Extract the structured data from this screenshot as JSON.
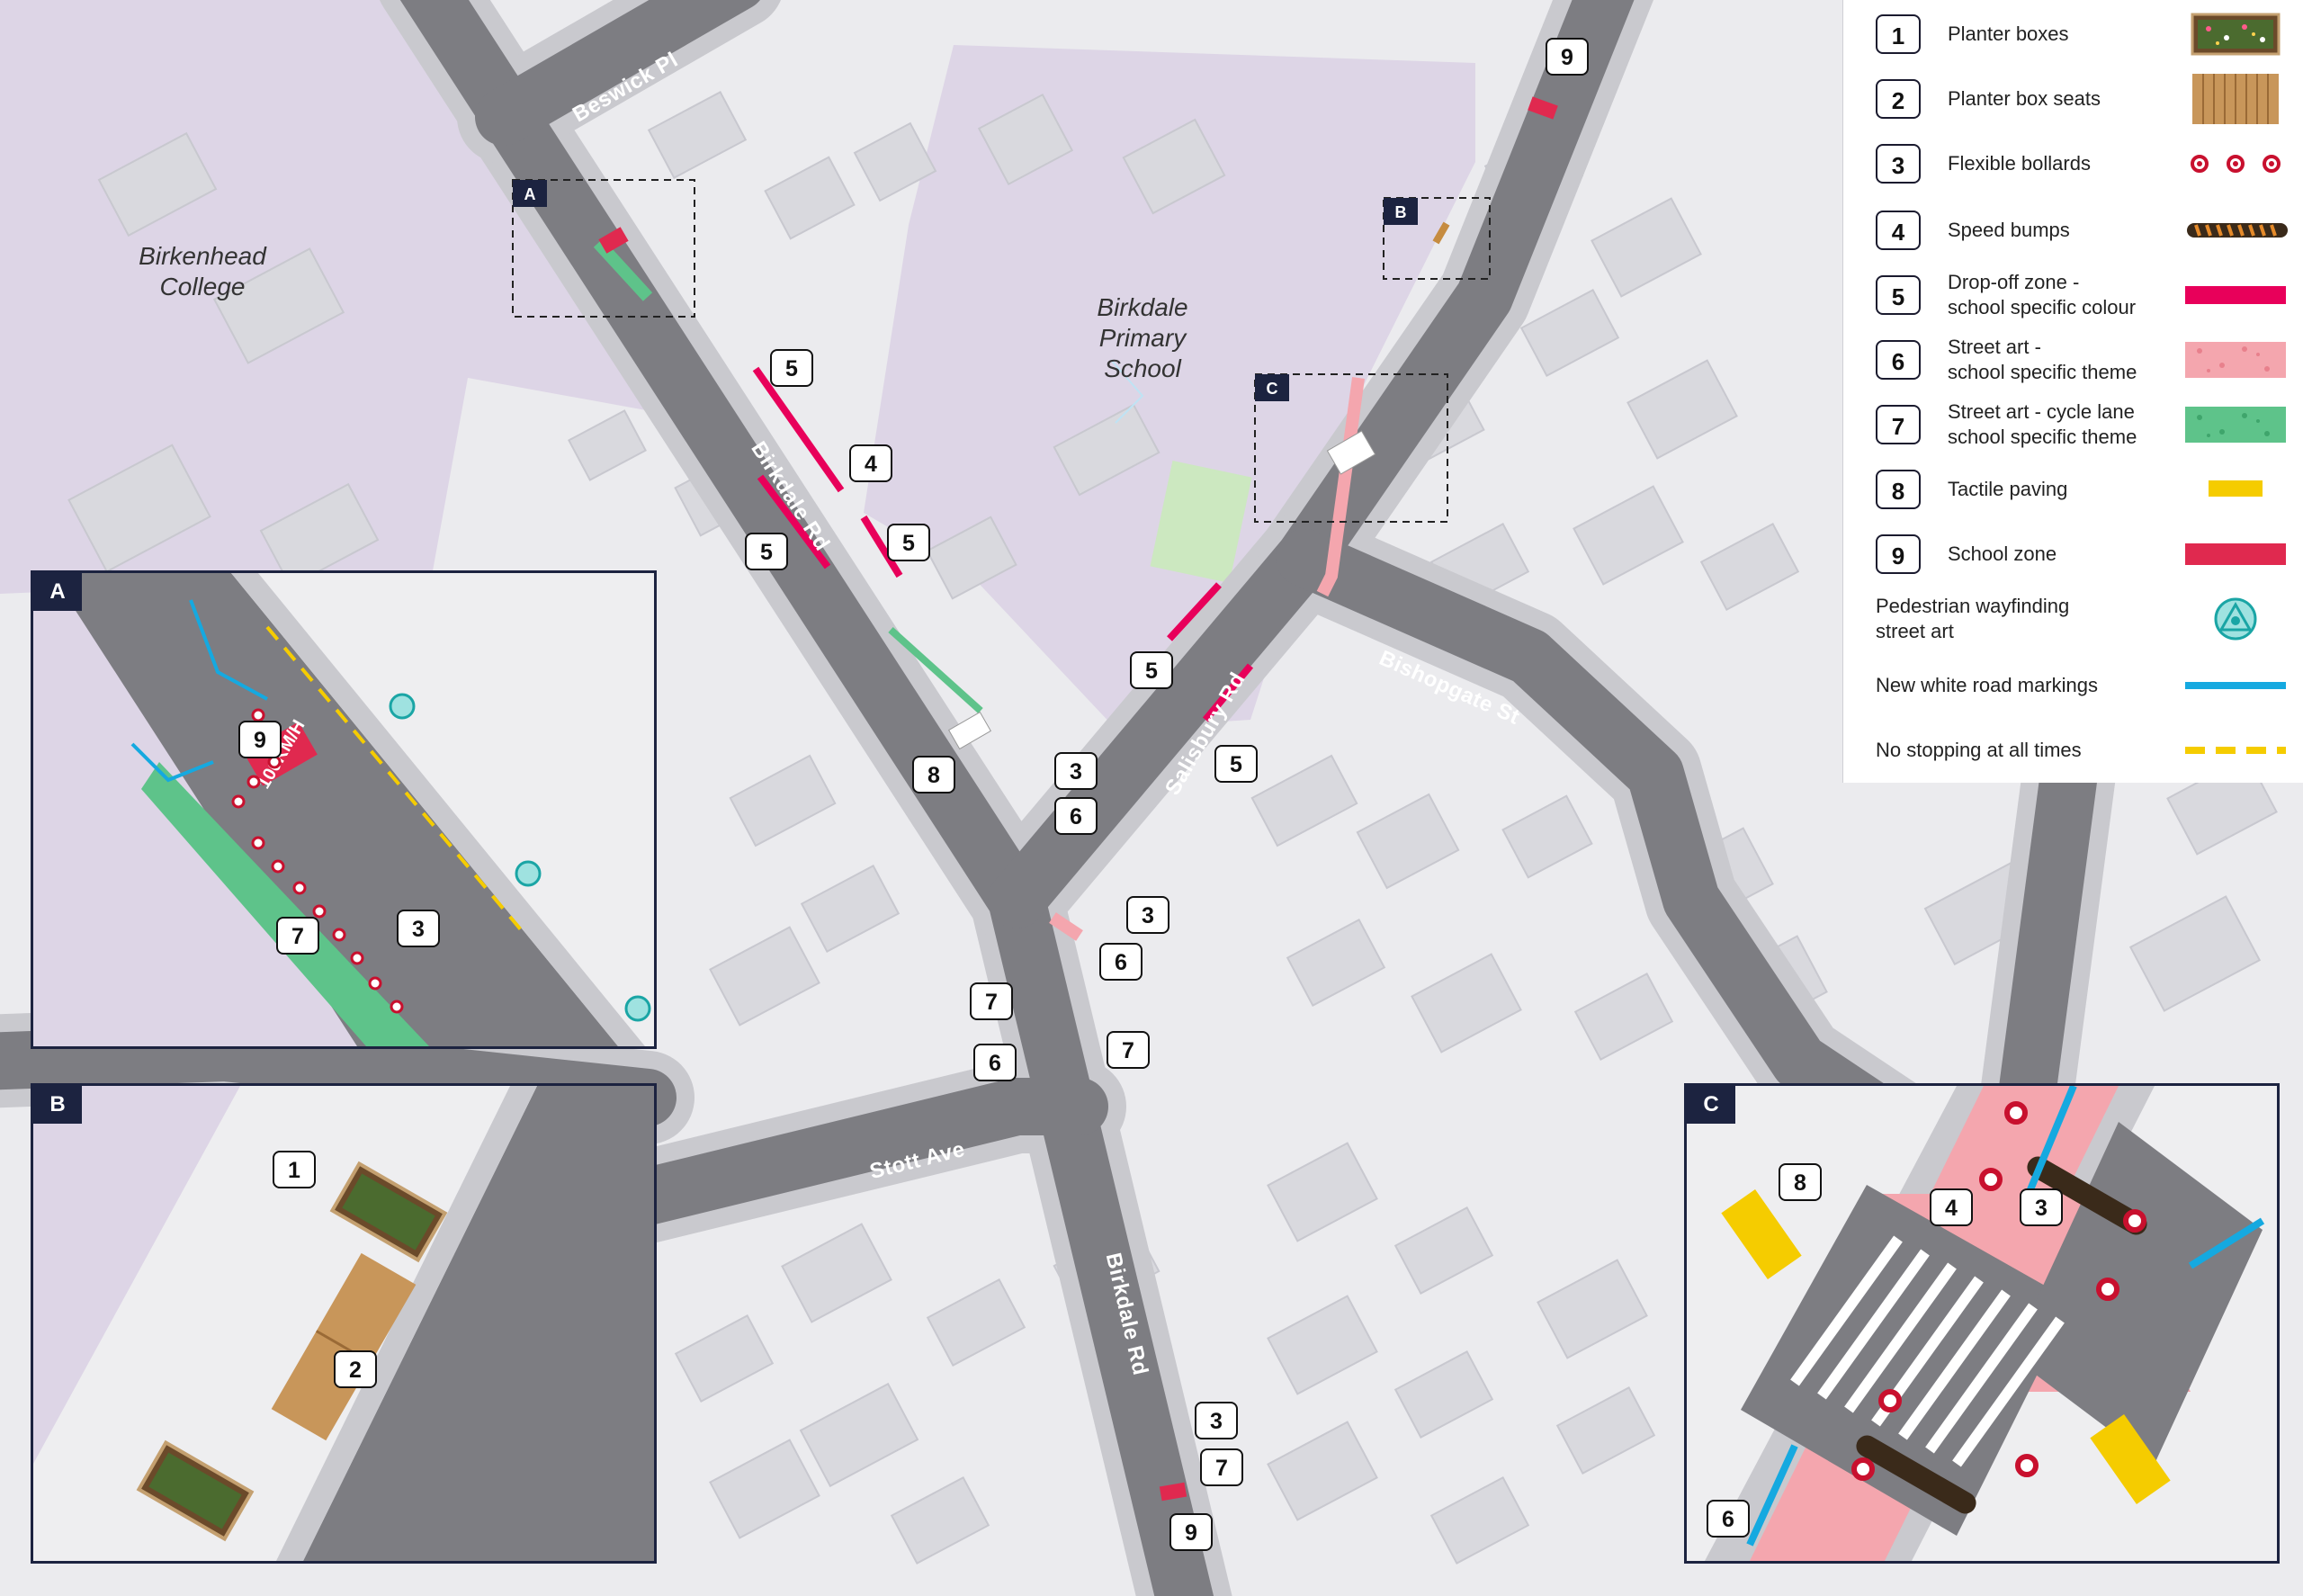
{
  "colors": {
    "road": "#7d7d82",
    "footpath": "#f3f3f5",
    "building": "#dcdce0",
    "school_ground": "#ddd5e6",
    "field": "#cce8c0",
    "drop_off": "#e8005a",
    "street_art": "#f4a6ae",
    "cycle_art": "#5ec38a",
    "tactile": "#f5cc00",
    "school_zone": "#e0294f",
    "white_markings": "#15a9e0",
    "no_stopping": "#f5cc00",
    "inset_frame": "#1c2340"
  },
  "legend": [
    {
      "num": "1",
      "label": "Planter boxes",
      "symbol": "planter-box"
    },
    {
      "num": "2",
      "label": "Planter box seats",
      "symbol": "planter-seat"
    },
    {
      "num": "3",
      "label": "Flexible bollards",
      "symbol": "bollard"
    },
    {
      "num": "4",
      "label": "Speed bumps",
      "symbol": "speed-bump"
    },
    {
      "num": "5",
      "label": "Drop-off zone -\nschool specific colour",
      "symbol": "drop-off"
    },
    {
      "num": "6",
      "label": "Street art -\nschool specific theme",
      "symbol": "street-art"
    },
    {
      "num": "7",
      "label": "Street art - cycle lane\nschool specific theme",
      "symbol": "cycle-art"
    },
    {
      "num": "8",
      "label": "Tactile paving",
      "symbol": "tactile"
    },
    {
      "num": "9",
      "label": "School zone",
      "symbol": "school-zone"
    },
    {
      "num": "",
      "label": "Pedestrian wayfinding\nstreet art",
      "symbol": "wayfinding"
    },
    {
      "num": "",
      "label": "New white road markings",
      "symbol": "white-marking"
    },
    {
      "num": "",
      "label": "No stopping at all times",
      "symbol": "no-stopping"
    }
  ],
  "streets": {
    "beswick": "Beswick Pl",
    "birkdale_north": "Birkdale Rd",
    "birkdale_south": "Birkdale Rd",
    "salisbury": "Salisbury Rd",
    "bishopgate": "Bishopgate St",
    "stott": "Stott Ave"
  },
  "places": {
    "college": "Birkenhead\nCollege",
    "school": "Birkdale\nPrimary\nSchool"
  },
  "map_tags": [
    "9",
    "5",
    "4",
    "5",
    "5",
    "5",
    "5",
    "8",
    "3",
    "6",
    "3",
    "6",
    "7",
    "6",
    "7",
    "3",
    "7",
    "9"
  ],
  "inset_a": {
    "letter": "A",
    "school_zone_text": "100KM/H",
    "tags": [
      "9",
      "7",
      "3"
    ]
  },
  "inset_b": {
    "letter": "B",
    "tags": [
      "1",
      "2"
    ]
  },
  "inset_c": {
    "letter": "C",
    "tags": [
      "8",
      "4",
      "3",
      "6"
    ]
  },
  "map_boxes": [
    "A",
    "B",
    "C"
  ]
}
